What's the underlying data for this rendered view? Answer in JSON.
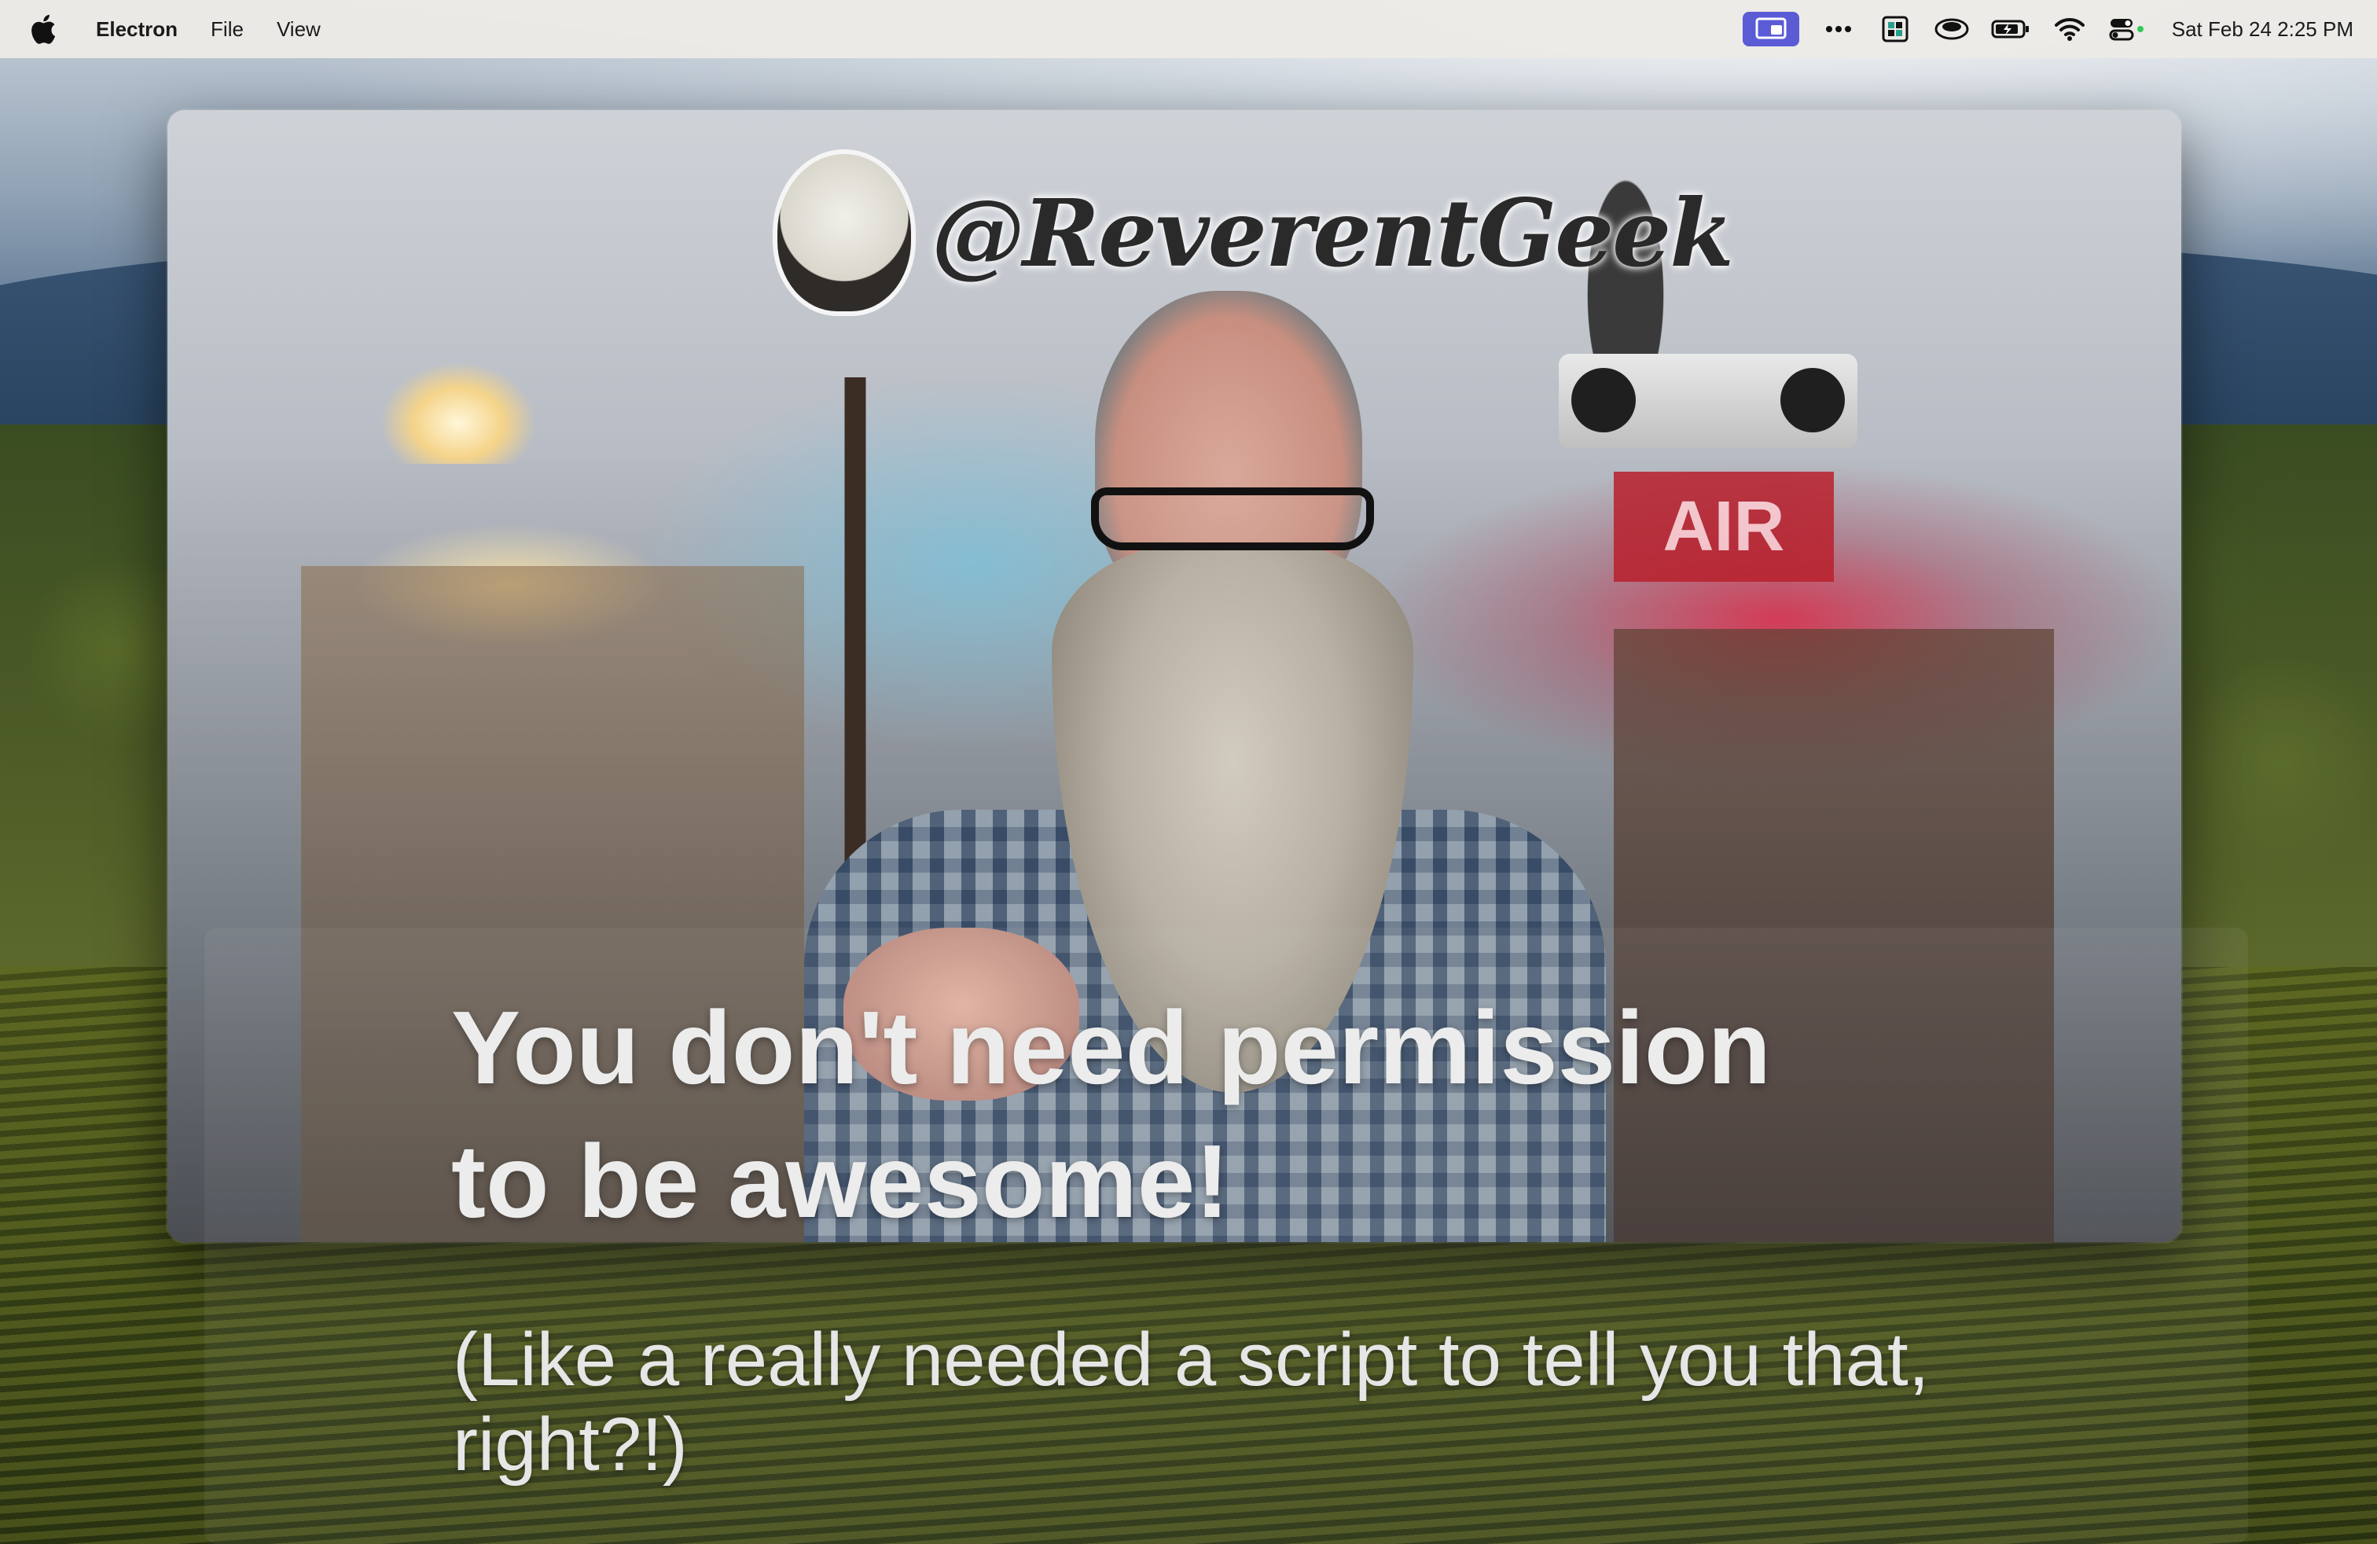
{
  "menubar": {
    "app_name": "Electron",
    "menus": [
      "File",
      "View"
    ],
    "clock": "Sat Feb 24  2:25 PM",
    "status_icons": [
      "screen-share-icon",
      "more-dots-icon",
      "app-tray-icon",
      "cloud-service-icon",
      "battery-icon",
      "wifi-icon",
      "control-center-icon"
    ],
    "active_icon_color": "#5b5bd6"
  },
  "video": {
    "logo_text": "@ReverentGeek",
    "on_air_text": "AIR"
  },
  "caption": {
    "main_line1": "You don't need permission",
    "main_line2": "to be awesome!",
    "sub_line1": "(Like a really needed a script to tell you that,",
    "sub_line2": "right?!)"
  }
}
